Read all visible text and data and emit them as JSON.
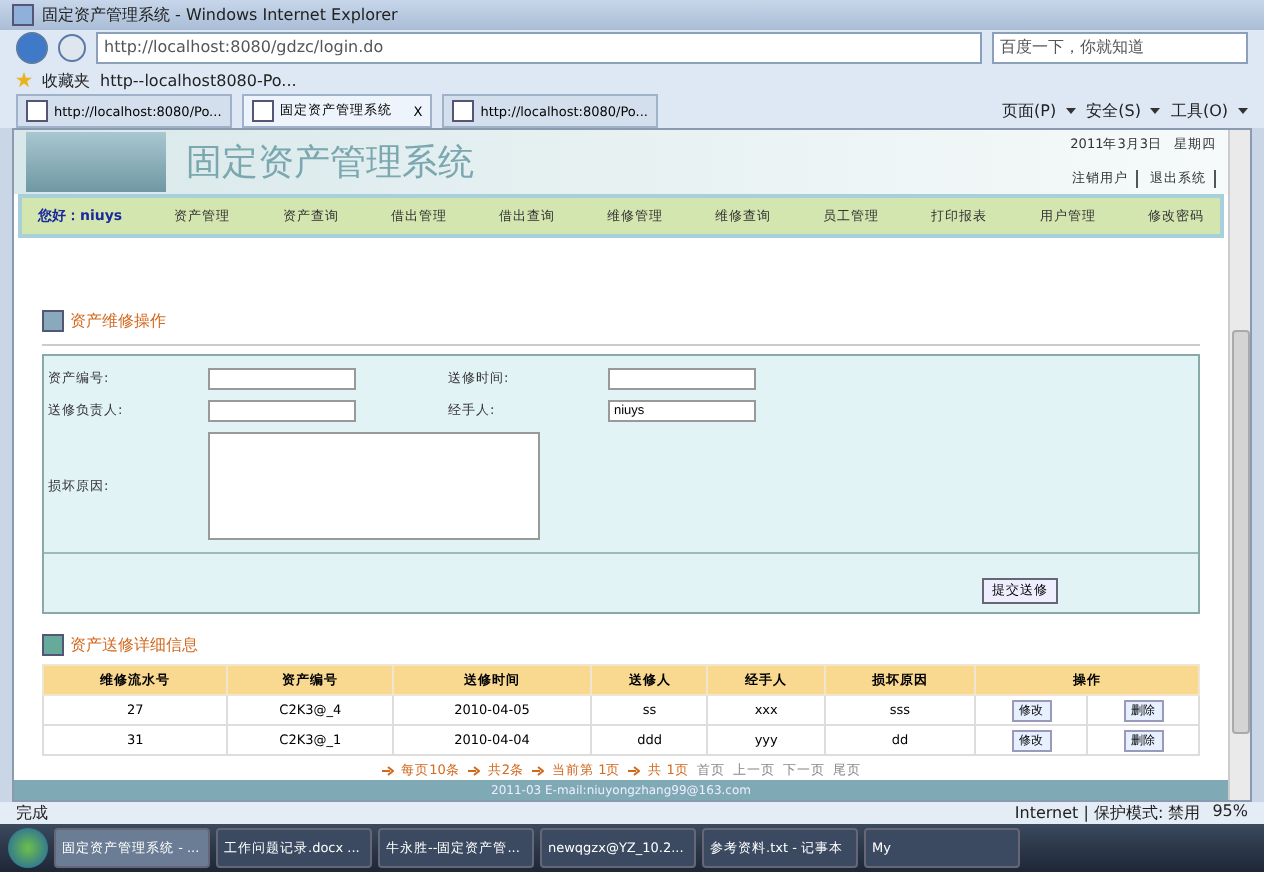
{
  "window": {
    "title": "固定资产管理系统 - Windows Internet Explorer"
  },
  "address_bar": {
    "url": "http://localhost:8080/gdzc/login.do",
    "search_placeholder": "百度一下，你就知道"
  },
  "favorites_bar": {
    "label": "收藏夹",
    "items": [
      "http--localhost8080-Po..."
    ]
  },
  "tabs": [
    {
      "label": "http://localhost:8080/Po...",
      "selected": false
    },
    {
      "label": "固定资产管理系统",
      "selected": true,
      "close": "X"
    },
    {
      "label": "http://localhost:8080/Po...",
      "selected": false
    }
  ],
  "command_bar": [
    "页面(P)",
    "安全(S)",
    "工具(O)"
  ],
  "page": {
    "header": {
      "title": "固定资产管理系统",
      "date": "2011年3月3日",
      "weekday": "星期四",
      "links": [
        "注销用户",
        "退出系统"
      ]
    },
    "nav": {
      "greeting": "您好：niuys",
      "items": [
        "资产管理",
        "资产查询",
        "借出管理",
        "借出查询",
        "维修管理",
        "维修查询",
        "员工管理",
        "打印报表",
        "用户管理",
        "修改密码"
      ]
    },
    "form": {
      "title": "资产维修操作",
      "fields": [
        {
          "kind": "input",
          "label": "资产编号:"
        },
        {
          "kind": "input",
          "label": "送修时间:"
        },
        {
          "kind": "input",
          "label": "送修负责人:"
        },
        {
          "kind": "input",
          "label": "经手人:",
          "value": "niuys"
        },
        {
          "kind": "textarea",
          "label": "损坏原因:"
        }
      ],
      "submit": "提交送修"
    },
    "table": {
      "title": "资产送修详细信息",
      "columns": [
        "维修流水号",
        "资产编号",
        "送修时间",
        "送修人",
        "经手人",
        "损坏原因",
        "操作"
      ],
      "rows": [
        {
          "cells": [
            "27",
            "C2K3@_4",
            "2010-04-05",
            "ss",
            "xxx",
            "sss"
          ],
          "actions": [
            "修改",
            "删除"
          ]
        },
        {
          "cells": [
            "31",
            "C2K3@_1",
            "2010-04-04",
            "ddd",
            "yyy",
            "dd"
          ],
          "actions": [
            "修改",
            "删除"
          ]
        }
      ]
    },
    "pagination": {
      "items": [
        "每页10条",
        "共2条",
        "当前第 1页",
        "共 1页"
      ],
      "links": [
        "首页",
        "上一页",
        "下一页",
        "尾页"
      ]
    },
    "footer": "2011-03 E-mail:niuyongzhang99@163.com"
  },
  "status_bar": {
    "text": "完成",
    "zone": "Internet | 保护模式: 禁用",
    "zoom": "95%"
  },
  "taskbar": [
    {
      "label": "固定资产管理系统 - ...",
      "selected": true
    },
    {
      "label": "工作问题记录.docx ...",
      "selected": false
    },
    {
      "label": "牛永胜--固定资产管...",
      "selected": false
    },
    {
      "label": "newqgzx@YZ_10.2...",
      "selected": false
    },
    {
      "label": "参考资料.txt - 记事本",
      "selected": false
    },
    {
      "label": "My",
      "selected": false
    }
  ]
}
